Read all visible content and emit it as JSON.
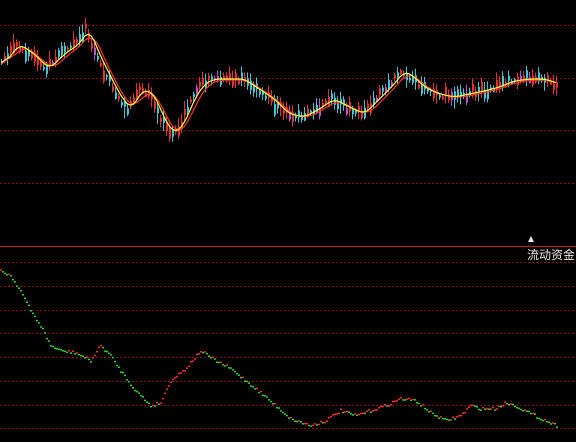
{
  "indicator": {
    "label": "流动资金"
  },
  "colors": {
    "background": "#000000",
    "grid": "#8a1010",
    "divider": "#c41a1a",
    "candle_up": "#e83030",
    "candle_down": "#3cc8d8",
    "candle_flat": "#c050d0",
    "ma_short": "#ffff40",
    "ma_long": "#ff3030",
    "flow_rising": "#ff2a2a",
    "flow_falling": "#30d030"
  },
  "icons": {
    "marker": "triangle-up-icon"
  }
}
